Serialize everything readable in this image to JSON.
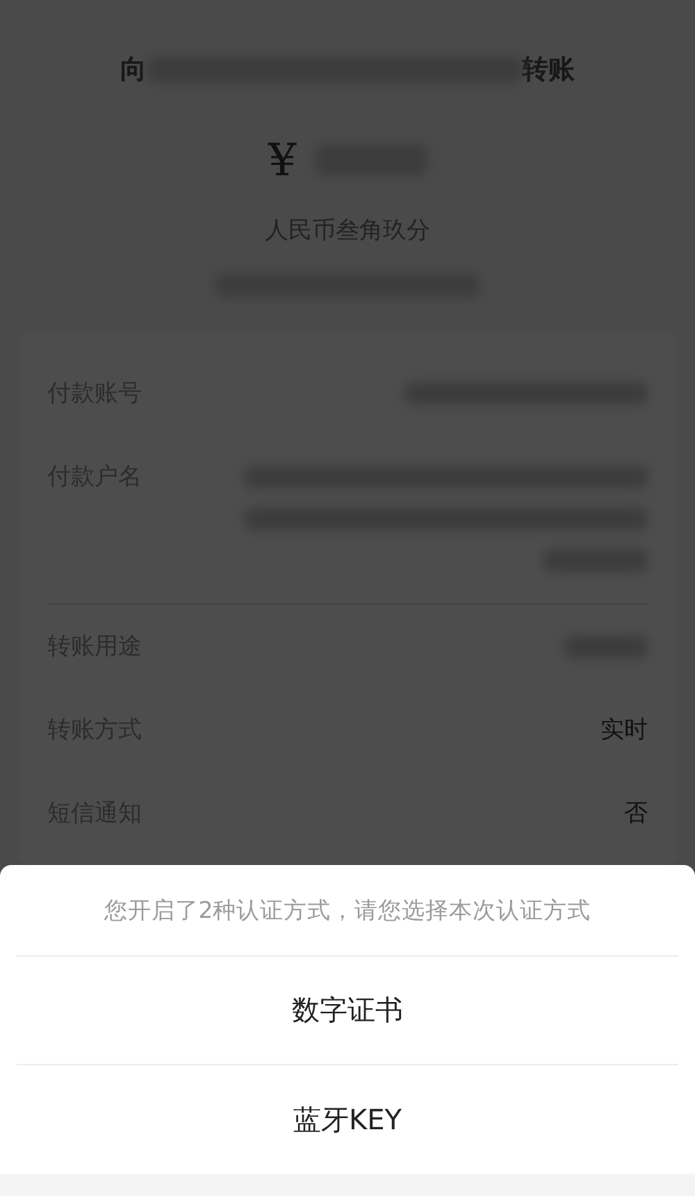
{
  "header": {
    "prefix": "向",
    "suffix": "转账",
    "currency": "¥",
    "amount_words": "人民币叁角玖分"
  },
  "details": [
    {
      "label": "付款账号",
      "kind": "blurred"
    },
    {
      "label": "付款户名",
      "kind": "blurred_multiline"
    },
    {
      "label": "转账用途",
      "kind": "blurred_short"
    },
    {
      "label": "转账方式",
      "kind": "text",
      "value": "实时"
    },
    {
      "label": "短信通知",
      "kind": "text",
      "value": "否"
    }
  ],
  "auth_sheet": {
    "prompt": "您开启了2种认证方式，请您选择本次认证方式",
    "options": [
      "数字证书",
      "蓝牙KEY"
    ]
  }
}
